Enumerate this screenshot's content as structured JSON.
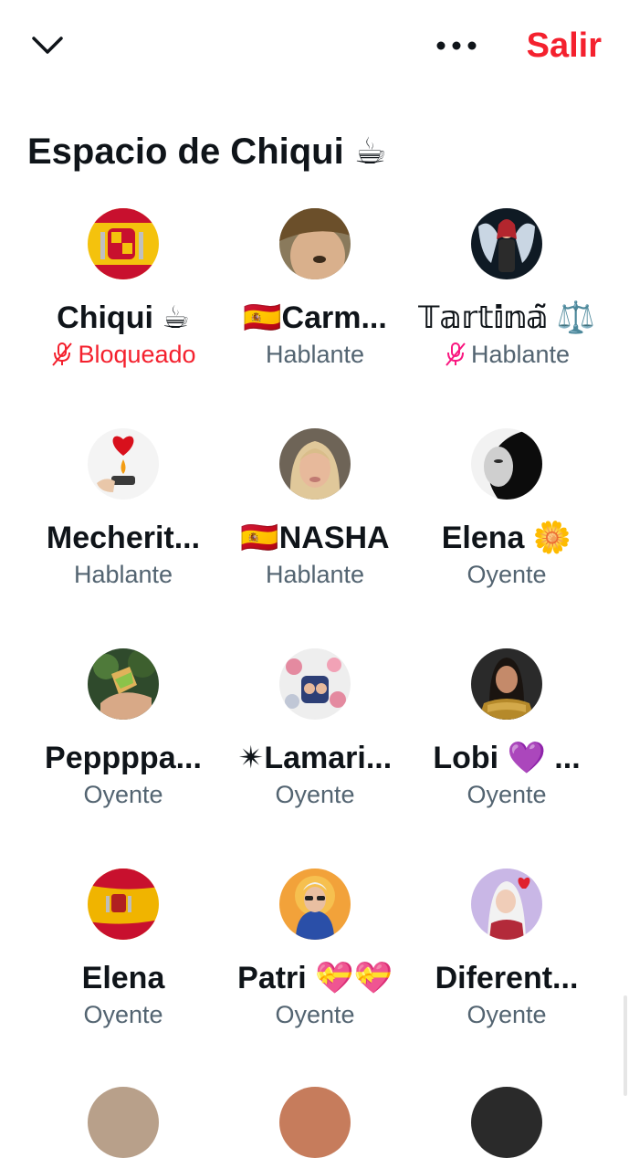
{
  "header": {
    "leave_label": "Salir",
    "collapse_icon": "chevron-down-icon",
    "more_icon": "more-horizontal-icon",
    "leave_color": "#f4212e"
  },
  "space": {
    "title": "Espacio de Chiqui ☕"
  },
  "participants": [
    {
      "name": "Chiqui ☕",
      "role": "Bloqueado",
      "muted": true,
      "role_color": "#f4212e"
    },
    {
      "name": "🇪🇸Carm...",
      "role": "Hablante",
      "muted": false
    },
    {
      "name": "𝕋𝕒𝕣𝕥𝕚𝕟𝕒̃ ⚖️",
      "role": "Hablante",
      "muted": true
    },
    {
      "name": "Mecherit...",
      "role": "Hablante",
      "muted": false
    },
    {
      "name": "🇪🇸NASHA",
      "role": "Hablante",
      "muted": false
    },
    {
      "name": "Elena 🌼",
      "role": "Oyente",
      "muted": false
    },
    {
      "name": "Peppppa...",
      "role": "Oyente",
      "muted": false
    },
    {
      "name": "✴Lamari...",
      "role": "Oyente",
      "muted": false
    },
    {
      "name": "Lobi 💜 ...",
      "role": "Oyente",
      "muted": false
    },
    {
      "name": "Elena",
      "role": "Oyente",
      "muted": false
    },
    {
      "name": "Patri 💝💝",
      "role": "Oyente",
      "muted": false
    },
    {
      "name": "Diferent...",
      "role": "Oyente",
      "muted": false
    }
  ],
  "colors": {
    "text": "#0f1419",
    "secondary": "#536471",
    "accent_red": "#f4212e"
  }
}
